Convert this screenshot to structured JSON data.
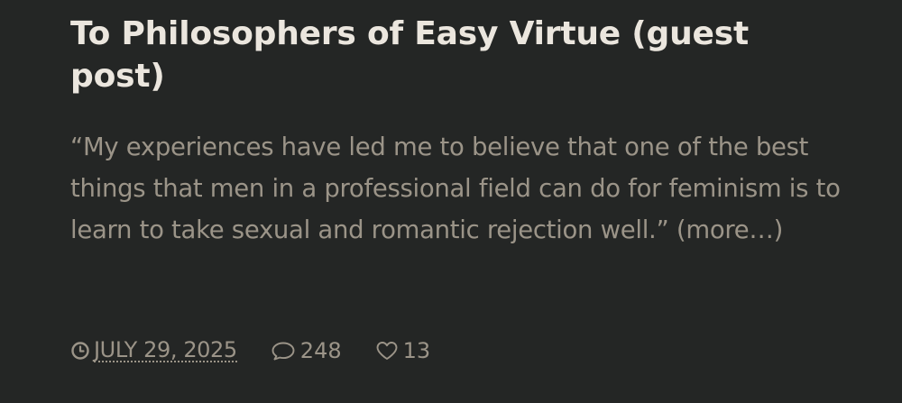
{
  "post": {
    "title": "To Philosophers of Easy Virtue (guest post)",
    "excerpt": "“My experiences have led me to believe that one of the best things that men in a professional field can do for feminism is to learn to take sexual and romantic rejection well.”",
    "more_label": "(more…)"
  },
  "meta": {
    "date": "JULY 29, 2025",
    "comments": "248",
    "likes": "13",
    "date_icon": "clock-icon",
    "comments_icon": "speech-bubble-icon",
    "likes_icon": "heart-icon"
  },
  "colors": {
    "background": "#242625",
    "title": "#ebe6de",
    "text": "#9b9488"
  }
}
